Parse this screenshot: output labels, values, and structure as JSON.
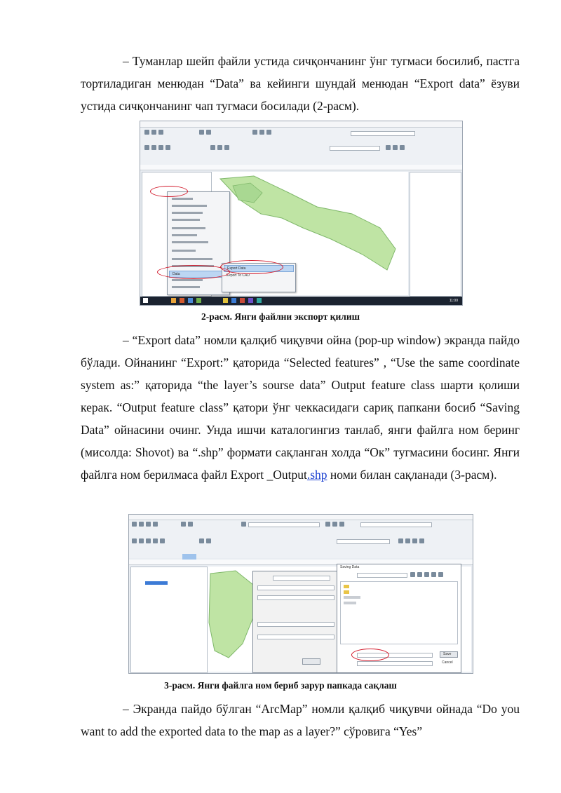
{
  "paragraphs": {
    "p1": "– Туманлар шейп файли устида сичқончанинг ўнг тугмаси босилиб, пастга тортиладиган менюдан “Data” ва кейинги шундай менюдан “Export data” ёзуви устида сичқончанинг чап тугмаси босилади (2-расм).",
    "p2_before_link": "– “Export data” номли қалқиб чиқувчи ойна (pop-up window) экранда пайдо бўлади. Ойнанинг “Export:” қаторида “Selected features” , “Use the same coordinate system as:” қаторида “the layer’s sourse data” Output feature class шарти қолиши керак. “Output feature class” қатори ўнг чеккасидаги сариқ папкани босиб “Saving Data” ойнасини очинг. Унда ишчи каталогингиз танлаб, янги файлга ном беринг (мисолда: Shovot) ва “.shp” формати сақланган холда “Ок” тугмасини босинг. Янги файлга ном берилмаса файл Export _Output",
    "p2_link": ".shp",
    "p2_after_link": " номи билан сақланади (3-расм).",
    "p3": "– Экранда пайдо бўлган “ArcMap”  номли қалқиб чиқувчи ойнада “Do you want to add the exported data to the map as a layer?” сўровига “Yes”"
  },
  "captions": {
    "fig2": "2-расм. Янги файлни экспорт қилиш",
    "fig3": "3-расм. Янги файлга ном бериб зарур папкада сақлаш"
  },
  "screenshots": {
    "fig2": {
      "menu_items": [
        "Data",
        "Export Data",
        "Export To CAD"
      ],
      "taskbar_time": "11:00"
    },
    "fig3": {
      "dialog_title": "Saving Data",
      "buttons": [
        "Save",
        "Cancel"
      ]
    }
  },
  "colors": {
    "map_land": "#bfe4a4",
    "map_land_stroke": "#7fb86a",
    "highlight_ellipse": "#d2192b",
    "link": "#1a3fd0"
  }
}
